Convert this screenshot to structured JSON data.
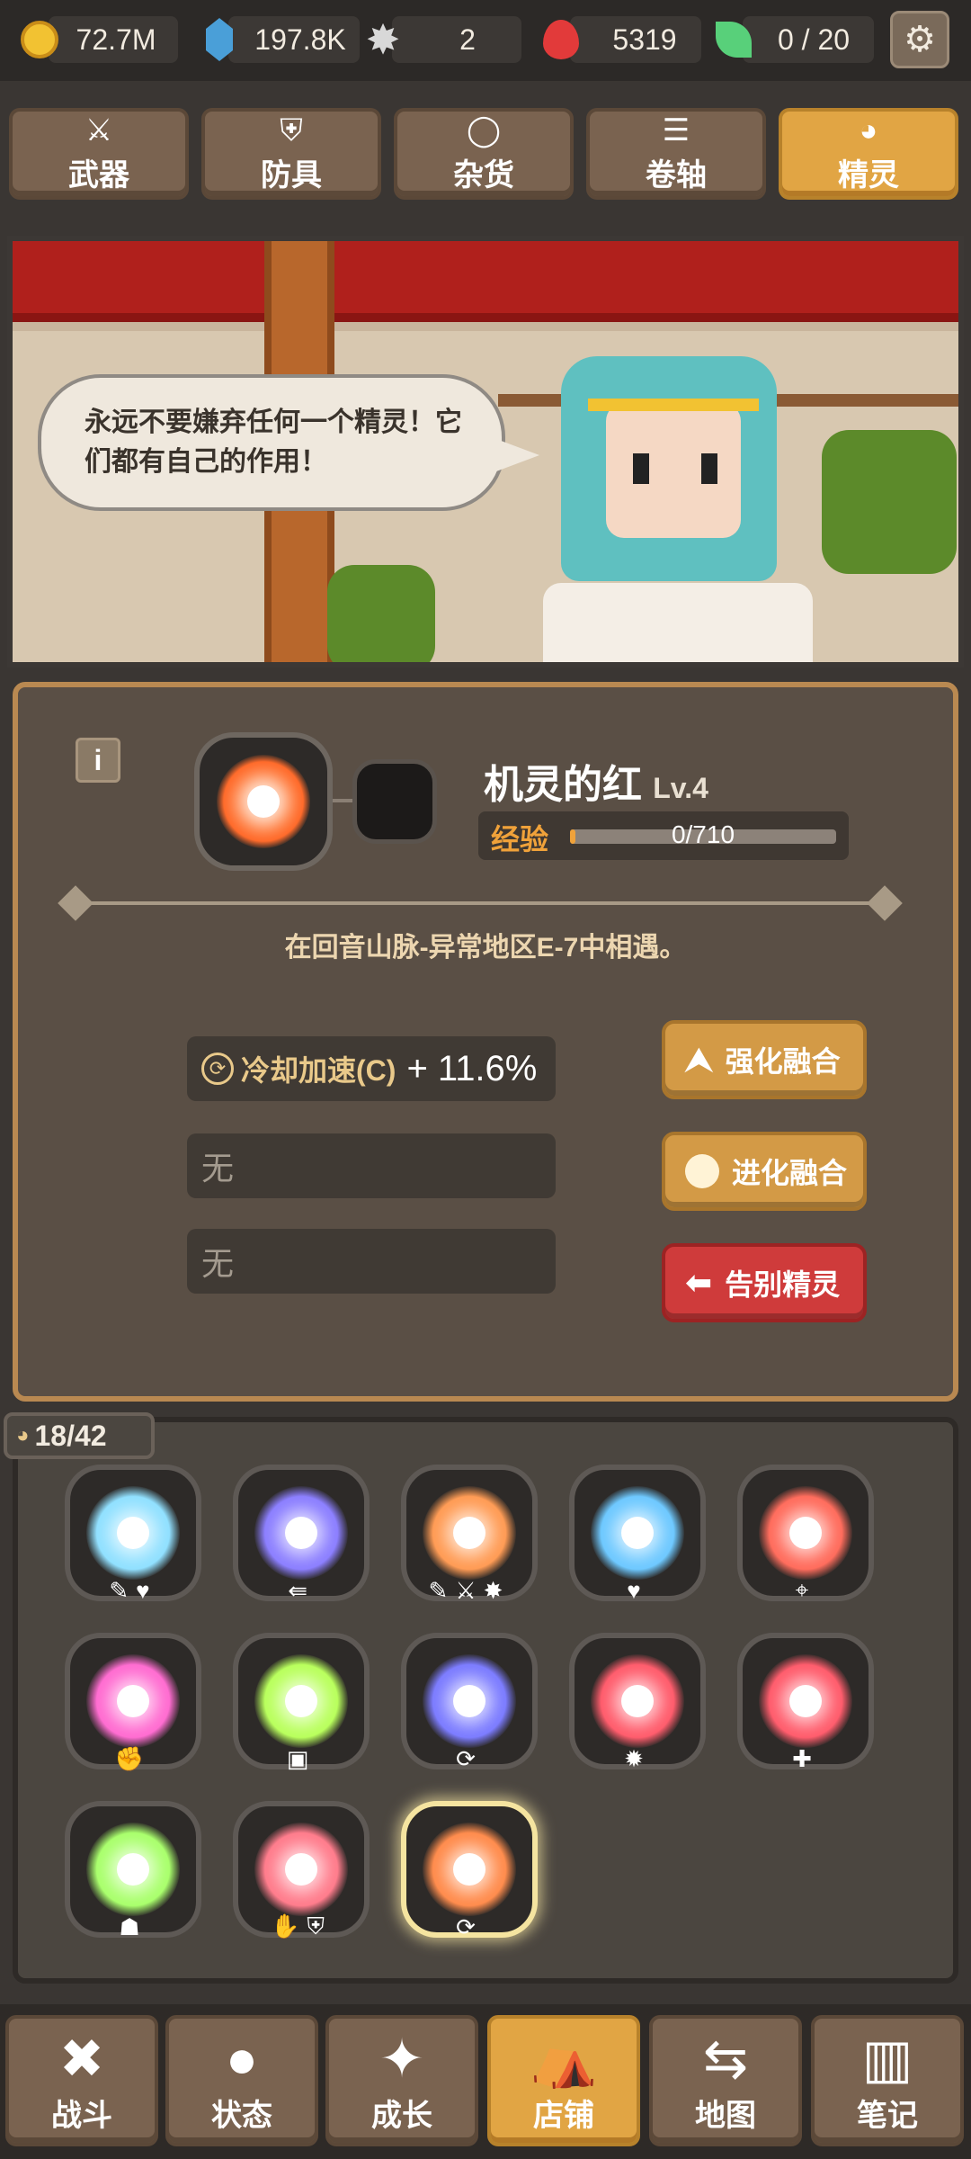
{
  "resources": [
    {
      "name": "gold",
      "value": "72.7M",
      "color": "#f2c232"
    },
    {
      "name": "crystal",
      "value": "197.8K",
      "color": "#4a9fd8"
    },
    {
      "name": "star-shard",
      "value": "2",
      "color": "#c9c9c9"
    },
    {
      "name": "soul",
      "value": "5319",
      "color": "#e23a3a"
    },
    {
      "name": "spirit-leaf",
      "value": "0 / 20",
      "color": "#58d07a"
    }
  ],
  "tabs": [
    {
      "label": "武器",
      "icon": "sword-icon",
      "glyph": "⚔"
    },
    {
      "label": "防具",
      "icon": "armor-icon",
      "glyph": "⛨"
    },
    {
      "label": "杂货",
      "icon": "ring-icon",
      "glyph": "◯"
    },
    {
      "label": "卷轴",
      "icon": "scroll-icon",
      "glyph": "☰"
    },
    {
      "label": "精灵",
      "icon": "spirit-icon",
      "glyph": "◕",
      "active": true
    }
  ],
  "scene": {
    "speech": "永远不要嫌弃任何一个精灵！它们都有自己的作用！"
  },
  "detail": {
    "name": "机灵的红",
    "level": "Lv.4",
    "exp_label": "经验",
    "exp_text": "0/710",
    "exp_progress": 0.0,
    "location": "在回音山脉-异常地区E-7中相遇。",
    "stat1_label": "冷却加速(C)",
    "stat1_value": "+ 11.6%",
    "stat2": "无",
    "stat3": "无",
    "buttons": {
      "enhance": "强化融合",
      "evolve": "进化融合",
      "farewell": "告别精灵"
    }
  },
  "collection": {
    "count": "18/42"
  },
  "nav": [
    {
      "label": "战斗",
      "icon": "battle-icon",
      "glyph": "✖"
    },
    {
      "label": "状态",
      "icon": "status-icon",
      "glyph": "●"
    },
    {
      "label": "成长",
      "icon": "growth-icon",
      "glyph": "✦"
    },
    {
      "label": "店铺",
      "icon": "shop-icon",
      "glyph": "⛺",
      "active": true
    },
    {
      "label": "地图",
      "icon": "map-icon",
      "glyph": "⇆"
    },
    {
      "label": "笔记",
      "icon": "notes-icon",
      "glyph": "▥"
    }
  ],
  "spirits": [
    {
      "color": "#8fe0ff",
      "tags": "✎♥"
    },
    {
      "color": "#8a7dff",
      "tags": "⇚"
    },
    {
      "color": "#ff9a52",
      "tags": "✎⚔✸"
    },
    {
      "color": "#6cc8ff",
      "tags": "♥"
    },
    {
      "color": "#ff6a5a",
      "tags": "⌖"
    },
    {
      "color": "#ff6ad0",
      "tags": "✊"
    },
    {
      "color": "#b8ff5a",
      "tags": "▣"
    },
    {
      "color": "#7a7aff",
      "tags": "⟳"
    },
    {
      "color": "#ff5a6a",
      "tags": "✹"
    },
    {
      "color": "#ff5a6a",
      "tags": "✚"
    },
    {
      "color": "#a8ff6a",
      "tags": "☗"
    },
    {
      "color": "#ff7a8a",
      "tags": "✋⛨"
    },
    {
      "color": "#ff8a4a",
      "tags": "⟳",
      "selected": true
    }
  ]
}
